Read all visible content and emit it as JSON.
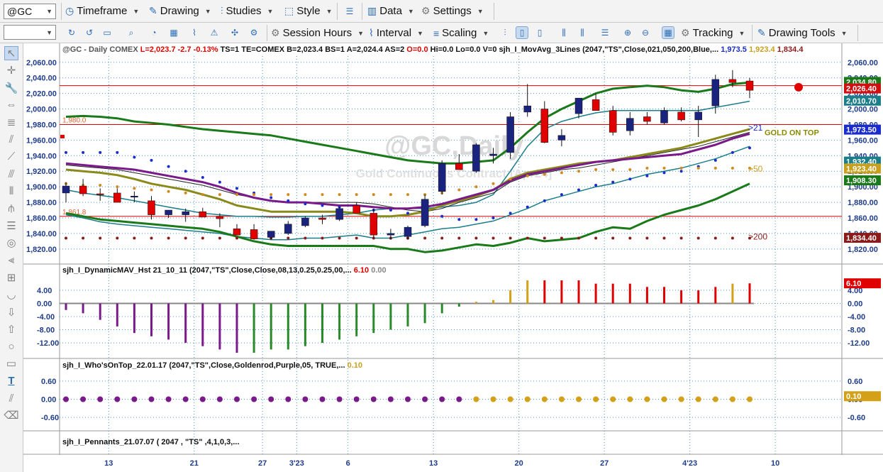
{
  "toolbar": {
    "symbol_value": "@GC",
    "second_value": "",
    "row1": [
      {
        "id": "timeframe",
        "icon": "timeframe-icon",
        "label": "Timeframe"
      },
      {
        "id": "drawing",
        "icon": "pencil-icon",
        "label": "Drawing"
      },
      {
        "id": "studies",
        "icon": "studies-icon",
        "label": "Studies"
      },
      {
        "id": "style",
        "icon": "style-icon",
        "label": "Style"
      },
      {
        "id": "data",
        "icon": "data-icon",
        "label": "Data"
      },
      {
        "id": "settings",
        "icon": "gear-icon",
        "label": "Settings"
      }
    ],
    "row2": [
      {
        "id": "session",
        "icon": "session-hours-icon",
        "label": "Session Hours"
      },
      {
        "id": "interval",
        "icon": "interval-icon",
        "label": "Interval"
      },
      {
        "id": "scaling",
        "icon": "scaling-icon",
        "label": "Scaling"
      },
      {
        "id": "tracking",
        "icon": "tracking-icon",
        "label": "Tracking"
      },
      {
        "id": "drawingtools",
        "icon": "drawing-tools-icon",
        "label": "Drawing Tools"
      }
    ]
  },
  "left_tools": [
    "arrow-icon",
    "crosshair-icon",
    "wrench-icon",
    "move-icon",
    "fib-icon",
    "fan-icon",
    "trendline-icon",
    "channel-icon",
    "bars-icon",
    "pitchfork-icon",
    "hlines-icon",
    "cycle-icon",
    "arc-icon",
    "zoom-icon",
    "curve-icon",
    "down-arrow-icon",
    "up-arrow-icon",
    "ellipse-icon",
    "rectangle-icon",
    "text-icon",
    "hatch-icon",
    "eraser-icon"
  ],
  "main_panel": {
    "header": [
      {
        "text": "@GC - Daily  COMEX",
        "color": "#555555"
      },
      {
        "text": "L=2,023.7  -2.7  -0.13%",
        "color": "#e00000"
      },
      {
        "text": "TS=1  TE=COMEX  B=2,023.4  BS=1  A=2,024.4  AS=2",
        "color": "#111111"
      },
      {
        "text": "O=0.0",
        "color": "#e00000"
      },
      {
        "text": "Hi=0.0  Lo=0.0  V=0",
        "color": "#111111"
      },
      {
        "text": "sjh_I_MovAvg_3Lines (2047,\"TS\",Close,021,050,200,Blue,...",
        "color": "#111111"
      },
      {
        "text": "1,973.5",
        "color": "#1a2ccc"
      },
      {
        "text": "1,923.4",
        "color": "#c8a020"
      },
      {
        "text": "1,834.4",
        "color": "#8b1a1a"
      }
    ],
    "watermark_title": "@GC,Daily",
    "watermark_sub": "Gold Continuous Contract [Apr24]",
    "ylim": [
      1808,
      2068
    ],
    "y_ticks": [
      "1,820.00",
      "1,840.00",
      "1,860.00",
      "1,880.00",
      "1,900.00",
      "1,920.00",
      "1,940.00",
      "1,960.00",
      "1,980.00",
      "2,000.00",
      "2,020.00",
      "2,040.00",
      "2,060.00"
    ],
    "candles": [
      {
        "o": 1892,
        "h": 1906,
        "l": 1880,
        "c": 1901
      },
      {
        "o": 1901,
        "h": 1910,
        "l": 1888,
        "c": 1891
      },
      {
        "o": 1891,
        "h": 1898,
        "l": 1882,
        "c": 1890
      },
      {
        "o": 1892,
        "h": 1898,
        "l": 1880,
        "c": 1880
      },
      {
        "o": 1888,
        "h": 1894,
        "l": 1880,
        "c": 1888
      },
      {
        "o": 1882,
        "h": 1888,
        "l": 1858,
        "c": 1864
      },
      {
        "o": 1864,
        "h": 1870,
        "l": 1860,
        "c": 1870
      },
      {
        "o": 1864,
        "h": 1872,
        "l": 1855,
        "c": 1868
      },
      {
        "o": 1868,
        "h": 1873,
        "l": 1862,
        "c": 1861
      },
      {
        "o": 1862,
        "h": 1866,
        "l": 1848,
        "c": 1859
      },
      {
        "o": 1846,
        "h": 1852,
        "l": 1842,
        "c": 1838
      },
      {
        "o": 1845,
        "h": 1852,
        "l": 1838,
        "c": 1833
      },
      {
        "o": 1835,
        "h": 1842,
        "l": 1832,
        "c": 1843
      },
      {
        "o": 1840,
        "h": 1856,
        "l": 1838,
        "c": 1852
      },
      {
        "o": 1850,
        "h": 1862,
        "l": 1848,
        "c": 1860
      },
      {
        "o": 1860,
        "h": 1864,
        "l": 1852,
        "c": 1858
      },
      {
        "o": 1858,
        "h": 1874,
        "l": 1856,
        "c": 1872
      },
      {
        "o": 1876,
        "h": 1880,
        "l": 1866,
        "c": 1866
      },
      {
        "o": 1866,
        "h": 1872,
        "l": 1834,
        "c": 1838
      },
      {
        "o": 1838,
        "h": 1846,
        "l": 1832,
        "c": 1840
      },
      {
        "o": 1836,
        "h": 1850,
        "l": 1832,
        "c": 1848
      },
      {
        "o": 1850,
        "h": 1890,
        "l": 1848,
        "c": 1884
      },
      {
        "o": 1894,
        "h": 1934,
        "l": 1890,
        "c": 1930
      },
      {
        "o": 1930,
        "h": 1942,
        "l": 1924,
        "c": 1922
      },
      {
        "o": 1920,
        "h": 1956,
        "l": 1918,
        "c": 1954
      },
      {
        "o": 1940,
        "h": 1950,
        "l": 1930,
        "c": 1942
      },
      {
        "o": 1944,
        "h": 1996,
        "l": 1936,
        "c": 1990
      },
      {
        "o": 1996,
        "h": 2032,
        "l": 1990,
        "c": 2004
      },
      {
        "o": 2000,
        "h": 2010,
        "l": 1956,
        "c": 1957
      },
      {
        "o": 1960,
        "h": 1974,
        "l": 1952,
        "c": 1966
      },
      {
        "o": 1994,
        "h": 2014,
        "l": 1988,
        "c": 2014
      },
      {
        "o": 2012,
        "h": 2020,
        "l": 2000,
        "c": 1998
      },
      {
        "o": 1998,
        "h": 2004,
        "l": 1966,
        "c": 1970
      },
      {
        "o": 1972,
        "h": 1996,
        "l": 1966,
        "c": 1988
      },
      {
        "o": 1990,
        "h": 1996,
        "l": 1980,
        "c": 1984
      },
      {
        "o": 1982,
        "h": 2002,
        "l": 1980,
        "c": 1998
      },
      {
        "o": 1996,
        "h": 2002,
        "l": 1984,
        "c": 1986
      },
      {
        "o": 1986,
        "h": 2004,
        "l": 1964,
        "c": 1996
      },
      {
        "o": 2004,
        "h": 2044,
        "l": 1994,
        "c": 2038
      },
      {
        "o": 2038,
        "h": 2050,
        "l": 2028,
        "c": 2034
      },
      {
        "o": 2036,
        "h": 2040,
        "l": 2014,
        "c": 2024
      }
    ],
    "ma_green_upper": [
      1990,
      1991,
      1990,
      1988,
      1984,
      1982,
      1980,
      1977,
      1974,
      1972,
      1970,
      1968,
      1966,
      1962,
      1958,
      1954,
      1950,
      1946,
      1942,
      1938,
      1934,
      1932,
      1930,
      1930,
      1932,
      1934,
      1950,
      1970,
      1988,
      2000,
      2010,
      2020,
      2026,
      2028,
      2030,
      2028,
      2024,
      2022,
      2026,
      2032,
      2034
    ],
    "ma_teal": [
      1896,
      1892,
      1889,
      1886,
      1882,
      1878,
      1874,
      1870,
      1866,
      1864,
      1862,
      1862,
      1861,
      1861,
      1862,
      1862,
      1864,
      1866,
      1870,
      1872,
      1872,
      1872,
      1874,
      1876,
      1880,
      1890,
      1920,
      1952,
      1974,
      1984,
      1990,
      1995,
      1998,
      1998,
      1998,
      1998,
      1998,
      1998,
      2002,
      2006,
      2010
    ],
    "ma_black": [
      1928,
      1926,
      1924,
      1922,
      1918,
      1914,
      1910,
      1906,
      1902,
      1896,
      1890,
      1886,
      1882,
      1880,
      1880,
      1880,
      1880,
      1880,
      1878,
      1874,
      1870,
      1868,
      1872,
      1880,
      1886,
      1892,
      1906,
      1914,
      1918,
      1922,
      1924,
      1928,
      1932,
      1936,
      1940,
      1944,
      1948,
      1952,
      1958,
      1964,
      1970
    ],
    "ma_purple": [
      1930,
      1928,
      1926,
      1924,
      1922,
      1918,
      1914,
      1910,
      1906,
      1900,
      1892,
      1886,
      1882,
      1880,
      1880,
      1878,
      1876,
      1876,
      1874,
      1872,
      1872,
      1874,
      1878,
      1884,
      1890,
      1896,
      1908,
      1916,
      1920,
      1924,
      1928,
      1932,
      1934,
      1936,
      1938,
      1940,
      1942,
      1948,
      1954,
      1962,
      1968
    ],
    "ma_olive": [
      1922,
      1920,
      1918,
      1915,
      1910,
      1904,
      1900,
      1896,
      1890,
      1884,
      1876,
      1872,
      1868,
      1868,
      1868,
      1868,
      1868,
      1866,
      1862,
      1862,
      1864,
      1868,
      1876,
      1882,
      1888,
      1896,
      1910,
      1918,
      1922,
      1926,
      1930,
      1932,
      1934,
      1938,
      1942,
      1946,
      1950,
      1956,
      1962,
      1968,
      1974
    ],
    "ma_green_lower": [
      1866,
      1862,
      1858,
      1856,
      1854,
      1852,
      1850,
      1848,
      1846,
      1842,
      1836,
      1830,
      1826,
      1824,
      1824,
      1824,
      1824,
      1824,
      1824,
      1820,
      1820,
      1816,
      1818,
      1822,
      1826,
      1824,
      1828,
      1834,
      1830,
      1832,
      1834,
      1842,
      1848,
      1846,
      1856,
      1864,
      1870,
      1876,
      1884,
      1894,
      1904
    ],
    "ma_lower_extra": [
      1864,
      1860,
      1855,
      1852,
      1850,
      1848,
      1846,
      1844,
      1842,
      1840,
      1836,
      1834,
      1832,
      1832,
      1834,
      1834,
      1836,
      1838,
      1834,
      1834,
      1838,
      1842,
      1846,
      1848,
      1852,
      1856,
      1864,
      1872,
      1882,
      1888,
      1894,
      1900,
      1904,
      1910,
      1916,
      1920,
      1924,
      1930,
      1936,
      1944,
      1952
    ],
    "dots_blue": [
      1944,
      1944,
      1944,
      1944,
      1938,
      1934,
      1926,
      1920,
      1912,
      1906,
      1898,
      1892,
      1886,
      1882,
      1878,
      1876,
      1874,
      1872,
      1870,
      1870,
      1866,
      1864,
      1862,
      1858,
      1858,
      1860,
      1866,
      1874,
      1882,
      1890,
      1896,
      1902,
      1906,
      1910,
      1914,
      1918,
      1920,
      1926,
      1934,
      1944,
      1950
    ],
    "dots_gold": [
      1904,
      1902,
      1902,
      1900,
      1898,
      1896,
      1894,
      1892,
      1890,
      1890,
      1890,
      1890,
      1890,
      1890,
      1890,
      1890,
      1890,
      1890,
      1890,
      1890,
      1890,
      1890,
      1892,
      1896,
      1900,
      1904,
      1910,
      1914,
      1916,
      1918,
      1920,
      1922,
      1922,
      1922,
      1924,
      1924,
      1924,
      1924,
      1924,
      1924,
      1924
    ],
    "dots_red": [
      1834,
      1834,
      1834,
      1834,
      1834,
      1834,
      1834,
      1834,
      1834,
      1834,
      1834,
      1834,
      1834,
      1834,
      1834,
      1834,
      1834,
      1834,
      1834,
      1834,
      1834,
      1834,
      1834,
      1834,
      1834,
      1834,
      1834,
      1834,
      1834,
      1834,
      1834,
      1834,
      1834,
      1834,
      1834,
      1834,
      1834,
      1834,
      1834,
      1834,
      1834
    ],
    "hlines": [
      {
        "value": 2030,
        "label": "",
        "color": "#e00000"
      },
      {
        "value": 1980,
        "label": "1,980.0",
        "color": "#e00000"
      },
      {
        "value": 1862,
        "label": "1,861.8",
        "color": "#e00000"
      }
    ],
    "labels": {
      "ma21": ">21",
      "ma50": ">50",
      "ma200": ">200",
      "gold_on_top": "GOLD ON TOP"
    },
    "right_tags": [
      {
        "text": "2,034.80",
        "value": 2034.8,
        "color": "#1a7a1a"
      },
      {
        "text": "2,026.40",
        "value": 2026.4,
        "color": "#d01010"
      },
      {
        "text": "2,010.70",
        "value": 2010.7,
        "color": "#1a7f8a"
      },
      {
        "text": "1,973.50",
        "value": 1973.5,
        "color": "#1a2ccc"
      },
      {
        "text": "1,932.40",
        "value": 1932.4,
        "color": "#1a7f8a"
      },
      {
        "text": "1,923.40",
        "value": 1923.4,
        "color": "#c8a020"
      },
      {
        "text": "1,908.30",
        "value": 1908.3,
        "color": "#1a7a1a"
      },
      {
        "text": "1,834.40",
        "value": 1834.4,
        "color": "#8b1a1a"
      }
    ]
  },
  "panel2": {
    "title": "sjh_I_DynamicMAV_Hst 21_10_11 (2047,\"TS\",Close,Close,08,13,0.25,0.25,00,...",
    "val1": "6.10",
    "val1_color": "#e00000",
    "val2": "0.00",
    "val2_color": "#888888",
    "ylim": [
      -15,
      7
    ],
    "y_ticks": [
      "4.00",
      "0.00",
      "-4.00",
      "-8.00",
      "-12.00"
    ],
    "y_tick_values": [
      4,
      0,
      -4,
      -8,
      -12
    ],
    "tag": {
      "text": "6.10",
      "value": 6.1,
      "color": "#e00000"
    },
    "bars": [
      {
        "v": -2,
        "c": "#7a1a8a"
      },
      {
        "v": -3,
        "c": "#7a1a8a"
      },
      {
        "v": -5,
        "c": "#7a1a8a"
      },
      {
        "v": -7,
        "c": "#7a1a8a"
      },
      {
        "v": -9,
        "c": "#7a1a8a"
      },
      {
        "v": -10,
        "c": "#7a1a8a"
      },
      {
        "v": -11,
        "c": "#7a1a8a"
      },
      {
        "v": -12,
        "c": "#7a1a8a"
      },
      {
        "v": -13,
        "c": "#7a1a8a"
      },
      {
        "v": -14,
        "c": "#7a1a8a"
      },
      {
        "v": -15,
        "c": "#7a1a8a"
      },
      {
        "v": -15,
        "c": "#2a8a2a"
      },
      {
        "v": -14,
        "c": "#2a8a2a"
      },
      {
        "v": -14,
        "c": "#2a8a2a"
      },
      {
        "v": -13,
        "c": "#2a8a2a"
      },
      {
        "v": -12,
        "c": "#2a8a2a"
      },
      {
        "v": -11,
        "c": "#2a8a2a"
      },
      {
        "v": -10,
        "c": "#2a8a2a"
      },
      {
        "v": -9,
        "c": "#2a8a2a"
      },
      {
        "v": -8,
        "c": "#2a8a2a"
      },
      {
        "v": -7,
        "c": "#2a8a2a"
      },
      {
        "v": -6,
        "c": "#2a8a2a"
      },
      {
        "v": -3,
        "c": "#2a8a2a"
      },
      {
        "v": -1,
        "c": "#2a8a2a"
      },
      {
        "v": 0.5,
        "c": "#d4a017"
      },
      {
        "v": 1,
        "c": "#d4a017"
      },
      {
        "v": 4,
        "c": "#d4a017"
      },
      {
        "v": 7,
        "c": "#d4a017"
      },
      {
        "v": 7,
        "c": "#e00000"
      },
      {
        "v": 7,
        "c": "#e00000"
      },
      {
        "v": 7,
        "c": "#e00000"
      },
      {
        "v": 6,
        "c": "#e00000"
      },
      {
        "v": 6,
        "c": "#e00000"
      },
      {
        "v": 6,
        "c": "#e00000"
      },
      {
        "v": 5,
        "c": "#e00000"
      },
      {
        "v": 5,
        "c": "#e00000"
      },
      {
        "v": 4,
        "c": "#e00000"
      },
      {
        "v": 4,
        "c": "#e00000"
      },
      {
        "v": 5,
        "c": "#e00000"
      },
      {
        "v": 6,
        "c": "#d4a017"
      },
      {
        "v": 6.1,
        "c": "#e00000"
      }
    ]
  },
  "panel3": {
    "title": "sjh_I_Who'sOnTop_22.01.17 (2047,\"TS\",Close,Goldenrod,Purple,05, TRUE,...",
    "val": "0.10",
    "val_color": "#c8a020",
    "ylim": [
      -0.9,
      0.9
    ],
    "y_ticks": [
      "0.60",
      "0.00",
      "-0.60"
    ],
    "y_tick_values": [
      0.6,
      0,
      -0.6
    ],
    "tag": {
      "text": "0.10",
      "value": 0.1,
      "color": "#d4a017"
    },
    "purple_count": 24
  },
  "panel4": {
    "title": "sjh_I_Pennants_21.07.07 ( 2047 , \"TS\" ,4,1,0,3,..."
  },
  "x_axis": {
    "labels": [
      "13",
      "21",
      "27",
      "3'23",
      "6",
      "13",
      "20",
      "27",
      "4'23",
      "10"
    ],
    "bar_index": [
      3,
      8,
      12,
      14,
      17,
      22,
      27,
      32,
      37,
      42
    ]
  },
  "colors": {
    "up": "#1a237e",
    "down": "#e00000",
    "grid": "#4a90d9",
    "ma_green": "#1a7a1a",
    "ma_teal": "#1a7f8a",
    "ma_purple": "#7a1a8a",
    "ma_olive": "#8a8a1a"
  }
}
